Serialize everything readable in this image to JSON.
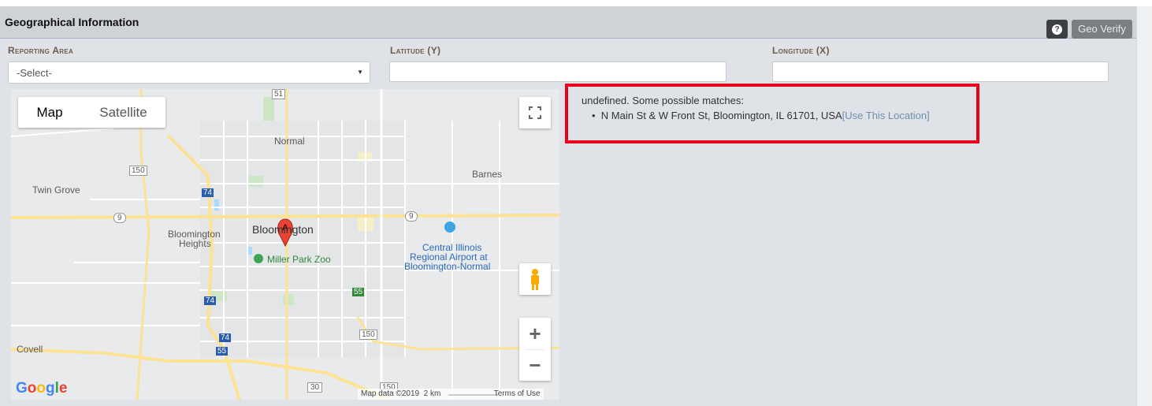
{
  "header": {
    "title": "Geographical Information",
    "help_icon": "?",
    "geo_verify_label": "Geo Verify"
  },
  "fields": {
    "reporting_area_label": "Reporting Area",
    "reporting_area_value": "-Select-",
    "latitude_label": "Latitude (Y)",
    "latitude_value": "",
    "longitude_label": "Longitude (X)",
    "longitude_value": ""
  },
  "map": {
    "tab_map": "Map",
    "tab_satellite": "Satellite",
    "zoom_in": "+",
    "zoom_out": "−",
    "labels": {
      "normal": "Normal",
      "barnes": "Barnes",
      "twin_grove": "Twin Grove",
      "bloomington_heights_1": "Bloomington",
      "bloomington_heights_2": "Heights",
      "bloomington": "Bloomington",
      "miller_park_zoo": "Miller Park Zoo",
      "airport_1": "Central Illinois",
      "airport_2": "Regional Airport at",
      "airport_3": "Bloomington-Normal",
      "covell": "Covell"
    },
    "shields": {
      "us51": "51",
      "us150_top": "150",
      "i74_a": "74",
      "il9_w": "9",
      "il9_e": "9",
      "i74_b": "74",
      "i55_a": "55",
      "i74_c": "74",
      "i55_b": "55",
      "us150_bottom": "150",
      "r30": "30",
      "r150_bottom2": "150"
    },
    "marker_letter": "A",
    "google_logo": "Google",
    "attribution_data": "Map data ©2019",
    "attribution_scale": "2 km",
    "attribution_terms": "Terms of Use"
  },
  "result": {
    "message": "undefined. Some possible matches:",
    "match_address": "N Main St & W Front St, Bloomington, IL 61701, USA",
    "match_link": "[Use This Location]"
  },
  "colors": {
    "highlight_border": "#e8001c",
    "link": "#6f8fad",
    "label": "#6c5c50"
  }
}
